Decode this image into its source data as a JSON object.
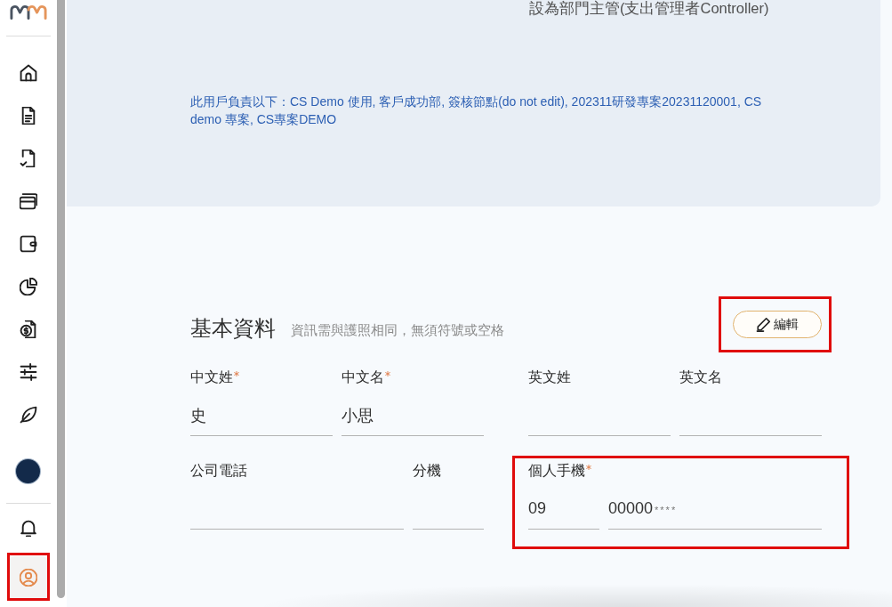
{
  "sidebar": {
    "nav_items": [
      {
        "selected": false,
        "highlighted": false
      },
      {
        "selected": false,
        "highlighted": false
      },
      {
        "selected": false,
        "highlighted": false
      },
      {
        "selected": false,
        "highlighted": false
      },
      {
        "selected": false,
        "highlighted": false
      },
      {
        "selected": false,
        "highlighted": false
      },
      {
        "selected": false,
        "highlighted": false
      },
      {
        "selected": false,
        "highlighted": false
      },
      {
        "selected": false,
        "highlighted": false
      }
    ],
    "account_items": [
      {
        "selected": false,
        "highlighted": false
      },
      {
        "selected": true,
        "highlighted": true
      }
    ]
  },
  "header_panel": {
    "role_note": "設為部門主管(支出管理者Controller)",
    "responsibility": "此用戶負責以下：CS Demo 使用, 客戶成功部, 簽核節點(do not edit), 202311研發專案20231120001, CS demo 專案, CS專案DEMO"
  },
  "basic_info": {
    "title": "基本資料",
    "hint": "資訊需與護照相同，無須符號或空格",
    "edit_button": {
      "label": "編輯",
      "highlighted": true
    },
    "rows": [
      {
        "fields": [
          {
            "label": "中文姓",
            "required": true,
            "highlighted": false,
            "inputs": [
              {
                "value": "史"
              }
            ]
          },
          {
            "label": "中文名",
            "required": true,
            "highlighted": false,
            "inputs": [
              {
                "value": "小思"
              }
            ]
          },
          {
            "label": "英文姓",
            "required": false,
            "highlighted": false
          },
          {
            "label": "英文名",
            "required": false,
            "highlighted": false
          }
        ]
      },
      {
        "fields": [
          {
            "label": "公司電話",
            "required": false,
            "highlighted": false
          },
          {
            "label": "分機",
            "required": false,
            "highlighted": false
          },
          {
            "label": "個人手機",
            "required": true,
            "highlighted": true,
            "inputs": [
              {
                "value": "09"
              },
              {
                "value": "00000",
                "masked": "****"
              }
            ]
          }
        ]
      }
    ]
  }
}
